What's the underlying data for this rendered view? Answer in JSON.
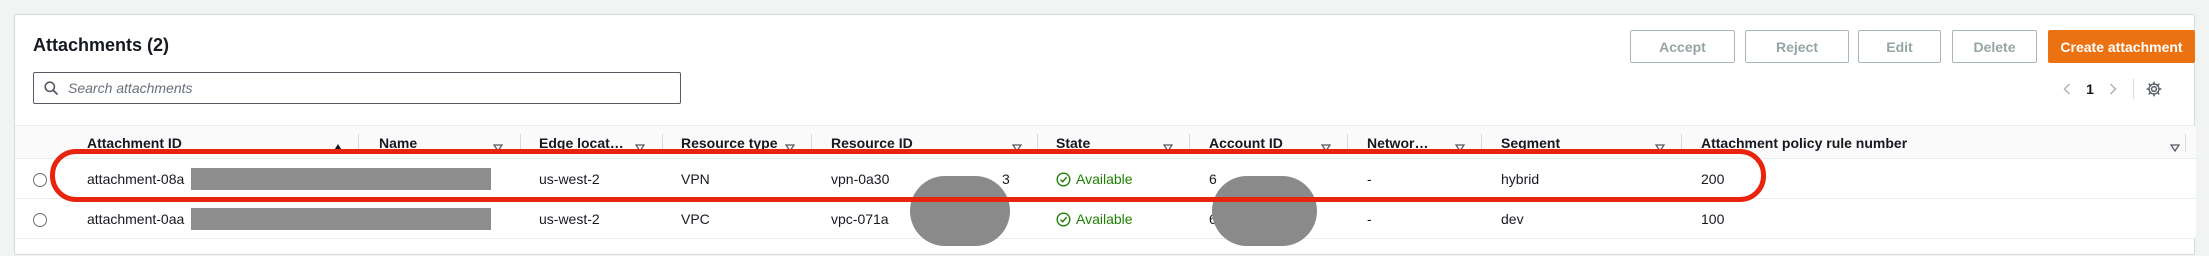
{
  "panel": {
    "title": "Attachments (2)",
    "buttons": {
      "accept": "Accept",
      "reject": "Reject",
      "edit": "Edit",
      "delete": "Delete",
      "create": "Create attachment"
    },
    "search_placeholder": "Search attachments",
    "pagination": {
      "current_page": "1"
    }
  },
  "table": {
    "columns": [
      "Attachment ID",
      "Name",
      "Edge locat…",
      "Resource type",
      "Resource ID",
      "State",
      "Account ID",
      "Networ…",
      "Segment",
      "Attachment policy rule number"
    ],
    "rows": [
      {
        "attachment_id": "attachment-08a",
        "edge_location": "us-west-2",
        "resource_type": "VPN",
        "resource_id": "vpn-0a30",
        "resource_id_tail": "3",
        "state": "Available",
        "account_id": "6",
        "network": "-",
        "segment": "hybrid",
        "policy_rule_number": "200"
      },
      {
        "attachment_id": "attachment-0aa",
        "edge_location": "us-west-2",
        "resource_type": "VPC",
        "resource_id": "vpc-071a",
        "resource_id_tail": "",
        "state": "Available",
        "account_id": "6",
        "network": "-",
        "segment": "dev",
        "policy_rule_number": "100"
      }
    ]
  },
  "colors": {
    "primary_button": "#ec7211",
    "status_available": "#1d8102",
    "highlight_annotation": "#e8240f",
    "redaction": "#8d8d8d"
  },
  "icons": {
    "search": "search-icon",
    "prev": "chevron-left-icon",
    "next": "chevron-right-icon",
    "settings": "gear-icon",
    "sort_asc": "sort-ascending-icon",
    "sort": "sort-icon",
    "status": "check-circle-icon"
  }
}
